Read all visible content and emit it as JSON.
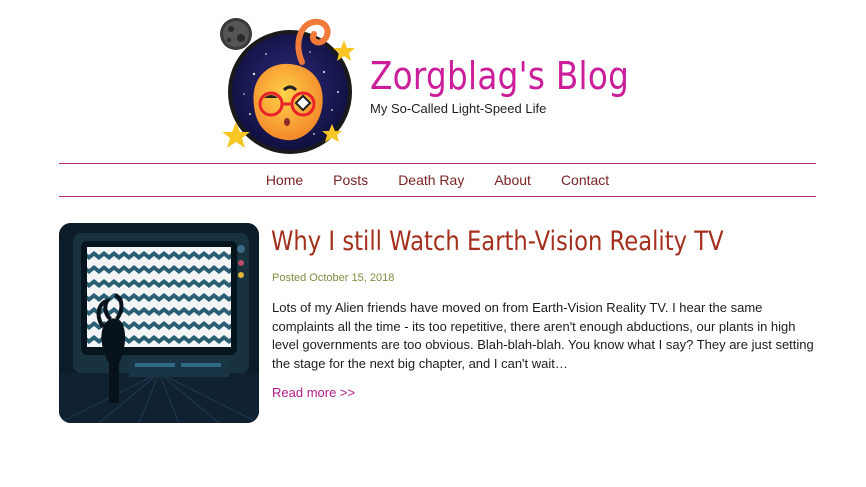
{
  "header": {
    "site_title": "Zorgblag's Blog",
    "tagline": "My So-Called Light-Speed Life"
  },
  "nav": {
    "items": [
      {
        "label": "Home"
      },
      {
        "label": "Posts"
      },
      {
        "label": "Death Ray"
      },
      {
        "label": "About"
      },
      {
        "label": "Contact"
      }
    ]
  },
  "post": {
    "title": "Why I still Watch Earth-Vision Reality TV",
    "meta": "Posted October 15, 2018",
    "excerpt": "Lots of my Alien friends have moved on from Earth-Vision Reality TV. I hear the same complaints all the time - its too repetitive, there aren't enough abductions, our plants in high level governments are too obvious. Blah-blah-blah. You know what I say? They are just setting the stage for the next big chapter, and I can't wait…",
    "read_more": "Read more >>",
    "thumbnail_icon": "alien-watching-tv-illustration"
  },
  "colors": {
    "title_magenta": "#cc1e9a",
    "nav_rule": "#b5267d",
    "nav_text": "#7a2424",
    "post_title": "#a32f1c",
    "meta_green": "#7b8e3f",
    "link_magenta": "#b21c8a"
  }
}
